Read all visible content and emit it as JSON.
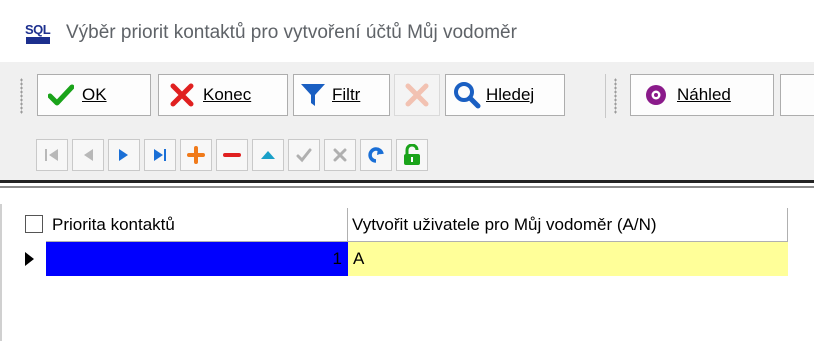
{
  "window": {
    "title": "Výběr priorit kontaktů pro vytvoření účtů Můj vodoměr",
    "icon_text": "SQL"
  },
  "toolbar": {
    "ok_label": "OK",
    "konec_label": "Konec",
    "filtr_label": "Filtr",
    "hledej_label": "Hledej",
    "nahled_label": "Náhled"
  },
  "nav_icons": [
    "first-icon",
    "prev-icon",
    "next-icon",
    "last-icon",
    "add-icon",
    "remove-icon",
    "up-icon",
    "confirm-icon",
    "cancel-icon",
    "refresh-icon",
    "unlock-icon"
  ],
  "grid": {
    "columns": [
      "Priorita kontaktů",
      "Vytvořit uživatele pro Můj vodoměr (A/N)"
    ],
    "rows": [
      {
        "priority": "1",
        "create_user": "A"
      }
    ]
  },
  "colors": {
    "selected_cell": "#0000ff",
    "edit_cell": "#ffff99",
    "accent": "#0a64c8"
  }
}
